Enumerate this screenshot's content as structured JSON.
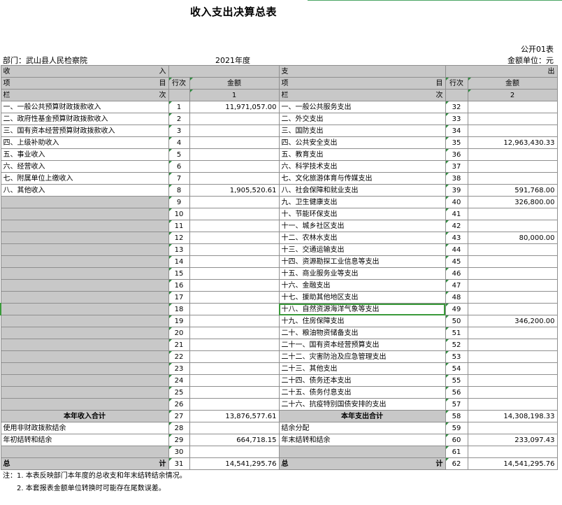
{
  "header": {
    "title": "收入支出决算总表",
    "form_code": "公开01表",
    "department": "部门：武山县人民检察院",
    "year": "2021年度",
    "unit": "金额单位：元"
  },
  "table": {
    "income_label": "收",
    "income_label_right": "入",
    "expense_label": "支",
    "expense_label_right": "出",
    "item_left": "项",
    "item_right": "目",
    "row_no_header": "行次",
    "amount_header": "金额",
    "col_left": "栏",
    "col_right": "次",
    "col_no_1": "1",
    "col_no_2": "2",
    "rows": [
      {
        "in_label": "一、一般公共预算财政拨款收入",
        "in_no": "1",
        "in_amt": "11,971,057.00",
        "ex_label": "一、一般公共服务支出",
        "ex_no": "32",
        "ex_amt": ""
      },
      {
        "in_label": "二、政府性基金预算财政拨款收入",
        "in_no": "2",
        "in_amt": "",
        "ex_label": "二、外交支出",
        "ex_no": "33",
        "ex_amt": ""
      },
      {
        "in_label": "三、国有资本经营预算财政拨款收入",
        "in_no": "3",
        "in_amt": "",
        "ex_label": "三、国防支出",
        "ex_no": "34",
        "ex_amt": ""
      },
      {
        "in_label": "四、上级补助收入",
        "in_no": "4",
        "in_amt": "",
        "ex_label": "四、公共安全支出",
        "ex_no": "35",
        "ex_amt": "12,963,430.33"
      },
      {
        "in_label": "五、事业收入",
        "in_no": "5",
        "in_amt": "",
        "ex_label": "五、教育支出",
        "ex_no": "36",
        "ex_amt": ""
      },
      {
        "in_label": "六、经营收入",
        "in_no": "6",
        "in_amt": "",
        "ex_label": "六、科学技术支出",
        "ex_no": "37",
        "ex_amt": ""
      },
      {
        "in_label": "七、附属单位上缴收入",
        "in_no": "7",
        "in_amt": "",
        "ex_label": "七、文化旅游体育与传媒支出",
        "ex_no": "38",
        "ex_amt": ""
      },
      {
        "in_label": "八、其他收入",
        "in_no": "8",
        "in_amt": "1,905,520.61",
        "ex_label": "八、社会保障和就业支出",
        "ex_no": "39",
        "ex_amt": "591,768.00"
      },
      {
        "in_label": "",
        "in_no": "9",
        "in_amt": "",
        "ex_label": "九、卫生健康支出",
        "ex_no": "40",
        "ex_amt": "326,800.00"
      },
      {
        "in_label": "",
        "in_no": "10",
        "in_amt": "",
        "ex_label": "十、节能环保支出",
        "ex_no": "41",
        "ex_amt": ""
      },
      {
        "in_label": "",
        "in_no": "11",
        "in_amt": "",
        "ex_label": "十一、城乡社区支出",
        "ex_no": "42",
        "ex_amt": ""
      },
      {
        "in_label": "",
        "in_no": "12",
        "in_amt": "",
        "ex_label": "十二、农林水支出",
        "ex_no": "43",
        "ex_amt": "80,000.00"
      },
      {
        "in_label": "",
        "in_no": "13",
        "in_amt": "",
        "ex_label": "十三、交通运输支出",
        "ex_no": "44",
        "ex_amt": ""
      },
      {
        "in_label": "",
        "in_no": "14",
        "in_amt": "",
        "ex_label": "十四、资源勘探工业信息等支出",
        "ex_no": "45",
        "ex_amt": ""
      },
      {
        "in_label": "",
        "in_no": "15",
        "in_amt": "",
        "ex_label": "十五、商业服务业等支出",
        "ex_no": "46",
        "ex_amt": ""
      },
      {
        "in_label": "",
        "in_no": "16",
        "in_amt": "",
        "ex_label": "十六、金融支出",
        "ex_no": "47",
        "ex_amt": ""
      },
      {
        "in_label": "",
        "in_no": "17",
        "in_amt": "",
        "ex_label": "十七、援助其他地区支出",
        "ex_no": "48",
        "ex_amt": ""
      },
      {
        "in_label": "",
        "in_no": "18",
        "in_amt": "",
        "ex_label": "十八、自然资源海洋气象等支出",
        "ex_no": "49",
        "ex_amt": ""
      },
      {
        "in_label": "",
        "in_no": "19",
        "in_amt": "",
        "ex_label": "十九、住房保障支出",
        "ex_no": "50",
        "ex_amt": "346,200.00"
      },
      {
        "in_label": "",
        "in_no": "20",
        "in_amt": "",
        "ex_label": "二十、粮油物资储备支出",
        "ex_no": "51",
        "ex_amt": ""
      },
      {
        "in_label": "",
        "in_no": "21",
        "in_amt": "",
        "ex_label": "二十一、国有资本经营预算支出",
        "ex_no": "52",
        "ex_amt": ""
      },
      {
        "in_label": "",
        "in_no": "22",
        "in_amt": "",
        "ex_label": "二十二、灾害防治及应急管理支出",
        "ex_no": "53",
        "ex_amt": ""
      },
      {
        "in_label": "",
        "in_no": "23",
        "in_amt": "",
        "ex_label": "二十三、其他支出",
        "ex_no": "54",
        "ex_amt": ""
      },
      {
        "in_label": "",
        "in_no": "24",
        "in_amt": "",
        "ex_label": "二十四、债务还本支出",
        "ex_no": "55",
        "ex_amt": ""
      },
      {
        "in_label": "",
        "in_no": "25",
        "in_amt": "",
        "ex_label": "二十五、债务付息支出",
        "ex_no": "56",
        "ex_amt": ""
      },
      {
        "in_label": "",
        "in_no": "26",
        "in_amt": "",
        "ex_label": "二十六、抗疫特别国债安排的支出",
        "ex_no": "57",
        "ex_amt": ""
      }
    ],
    "income_total_label": "本年收入合计",
    "income_total_no": "27",
    "income_total_amt": "13,876,577.61",
    "expense_total_label": "本年支出合计",
    "expense_total_no": "58",
    "expense_total_amt": "14,308,198.33",
    "bottom_rows": [
      {
        "in_label": "使用非财政拨款结余",
        "in_no": "28",
        "in_amt": "",
        "ex_label": "结余分配",
        "ex_no": "59",
        "ex_amt": ""
      },
      {
        "in_label": "年初结转和结余",
        "in_no": "29",
        "in_amt": "664,718.15",
        "ex_label": "年末结转和结余",
        "ex_no": "60",
        "ex_amt": "233,097.43"
      },
      {
        "in_label": "",
        "in_no": "30",
        "in_amt": "",
        "ex_label": "",
        "ex_no": "61",
        "ex_amt": ""
      }
    ],
    "grand_in_left": "总",
    "grand_in_right": "计",
    "grand_in_no": "31",
    "grand_in_amt": "14,541,295.76",
    "grand_ex_left": "总",
    "grand_ex_right": "计",
    "grand_ex_no": "62",
    "grand_ex_amt": "14,541,295.76"
  },
  "notes": {
    "line1": "注：1. 本表反映部门本年度的总收支和年末结转结余情况。",
    "line2": "2. 本套报表金额单位转换时可能存在尾数误差。"
  }
}
